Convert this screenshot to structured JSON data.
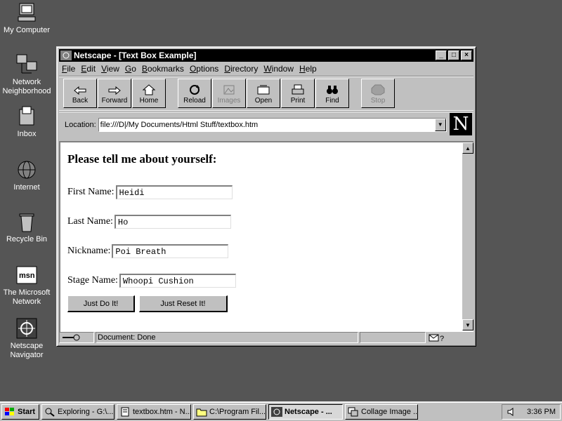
{
  "desktop": {
    "icons": [
      {
        "label": "My Computer",
        "icon": "computer-icon"
      },
      {
        "label": "Network Neighborhood",
        "icon": "network-icon"
      },
      {
        "label": "Inbox",
        "icon": "inbox-icon"
      },
      {
        "label": "Internet",
        "icon": "internet-icon"
      },
      {
        "label": "Recycle Bin",
        "icon": "recycle-bin-icon"
      },
      {
        "label": "The Microsoft Network",
        "icon": "msn-icon"
      },
      {
        "label": "Netscape Navigator",
        "icon": "netscape-icon"
      }
    ]
  },
  "window": {
    "title": "Netscape - [Text Box Example]",
    "menu": [
      "File",
      "Edit",
      "View",
      "Go",
      "Bookmarks",
      "Options",
      "Directory",
      "Window",
      "Help"
    ],
    "toolbar": {
      "back": "Back",
      "forward": "Forward",
      "home": "Home",
      "reload": "Reload",
      "images": "Images",
      "open": "Open",
      "print": "Print",
      "find": "Find",
      "stop": "Stop"
    },
    "location_label": "Location:",
    "location_value": "file:///D|/My Documents/Html Stuff/textbox.htm",
    "status": "Document: Done"
  },
  "page": {
    "heading": "Please tell me about yourself:",
    "fields": [
      {
        "label": "First Name:",
        "value": "Heidi"
      },
      {
        "label": "Last Name:",
        "value": "Ho"
      },
      {
        "label": "Nickname:",
        "value": "Poi Breath"
      },
      {
        "label": "Stage Name:",
        "value": "Whoopi Cushion"
      }
    ],
    "submit_label": "Just Do It!",
    "reset_label": "Just Reset It!"
  },
  "taskbar": {
    "start": "Start",
    "items": [
      {
        "label": "Exploring - G:\\...",
        "active": false
      },
      {
        "label": "textbox.htm - N...",
        "active": false
      },
      {
        "label": "C:\\Program Fil...",
        "active": false
      },
      {
        "label": "Netscape - ...",
        "active": true
      },
      {
        "label": "Collage Image ...",
        "active": false
      }
    ],
    "clock": "3:36 PM"
  }
}
